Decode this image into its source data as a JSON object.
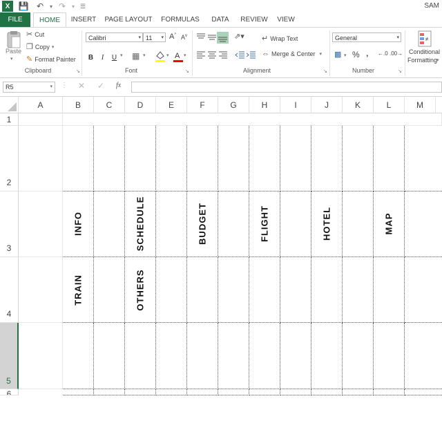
{
  "app": {
    "user": "SAM"
  },
  "tabs": [
    "FILE",
    "HOME",
    "INSERT",
    "PAGE LAYOUT",
    "FORMULAS",
    "DATA",
    "REVIEW",
    "VIEW"
  ],
  "ribbon": {
    "clipboard": {
      "label": "Clipboard",
      "paste": "Paste",
      "cut": "Cut",
      "copy": "Copy",
      "format_painter": "Format Painter"
    },
    "font": {
      "label": "Font",
      "name": "Calibri",
      "size": "11",
      "bold": "B",
      "italic": "I",
      "underline": "U"
    },
    "alignment": {
      "label": "Alignment",
      "wrap": "Wrap Text",
      "merge": "Merge & Center"
    },
    "number": {
      "label": "Number",
      "format": "General",
      "percent": "%"
    },
    "styles": {
      "conditional": "Conditional",
      "formatting": "Formatting"
    }
  },
  "formula_bar": {
    "name_box": "R5",
    "fx": "fx"
  },
  "columns": [
    "A",
    "B",
    "C",
    "D",
    "E",
    "F",
    "G",
    "H",
    "I",
    "J",
    "K",
    "L",
    "M"
  ],
  "rows": [
    "1",
    "2",
    "3",
    "4",
    "5",
    "6"
  ],
  "cells": {
    "b3": "INFO",
    "d3": "SCHEDULE",
    "f3": "BUDGET",
    "h3": "FLIGHT",
    "j3": "HOTEL",
    "l3": "MAP",
    "b4": "TRAIN",
    "d4": "OTHERS"
  },
  "colors": {
    "excel_green": "#217346",
    "selected_row": "#d3d3d3"
  }
}
